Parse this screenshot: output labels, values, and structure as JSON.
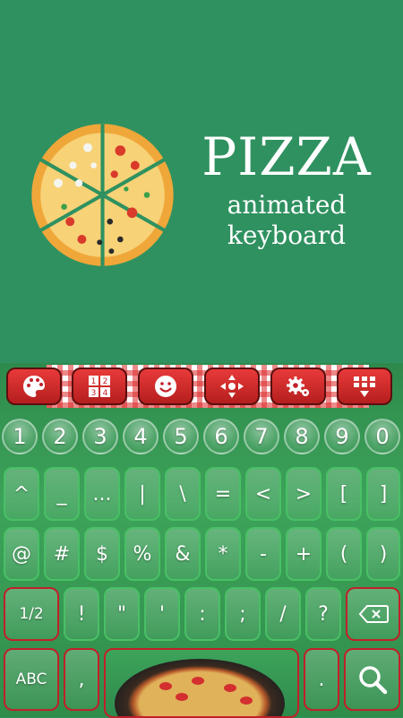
{
  "promo": {
    "title": "PIZZA",
    "subtitle_line1": "animated",
    "subtitle_line2": "keyboard"
  },
  "toolbar": {
    "buttons": [
      {
        "icon": "theme-palette-icon"
      },
      {
        "icon": "number-grid-icon"
      },
      {
        "icon": "emoji-smile-icon"
      },
      {
        "icon": "cursor-move-icon"
      },
      {
        "icon": "settings-gear-icon"
      },
      {
        "icon": "keyboard-hide-icon"
      }
    ]
  },
  "keys": {
    "numbers": [
      "1",
      "2",
      "3",
      "4",
      "5",
      "6",
      "7",
      "8",
      "9",
      "0"
    ],
    "row1": [
      "^",
      "_",
      "...",
      "|",
      "\\",
      "=",
      "<",
      ">",
      "[",
      "]"
    ],
    "row2": [
      "@",
      "#",
      "$",
      "%",
      "&",
      "*",
      "-",
      "+",
      "(",
      ")"
    ],
    "row3": [
      "1/2",
      "!",
      "\"",
      "'",
      ":",
      ";",
      "/",
      "?"
    ],
    "abc": "ABC",
    "comma": ",",
    "period": "."
  },
  "colors": {
    "background": "#2f9160",
    "key_border": "#49c066",
    "accent_red": "#c0202a"
  }
}
